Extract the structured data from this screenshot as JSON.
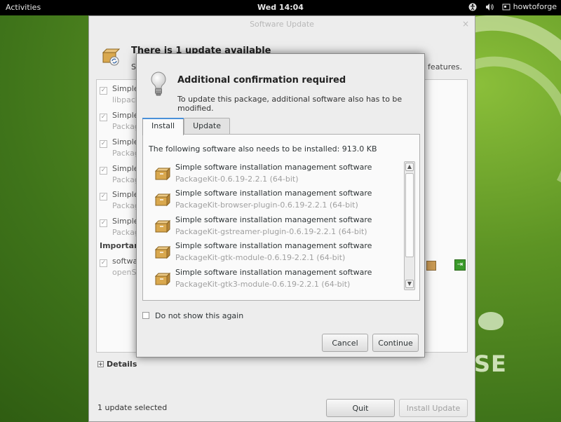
{
  "topbar": {
    "activities": "Activities",
    "clock": "Wed 14:04",
    "user": "howtoforge",
    "icons": [
      "accessibility-icon",
      "volume-icon",
      "user-icon"
    ]
  },
  "desktop": {
    "brand_text": "SE"
  },
  "software_update": {
    "title": "Software Update",
    "heading": "There is 1 update available",
    "subtitle_left": "S",
    "subtitle_right": "v features.",
    "rows": [
      {
        "line1": "Simple",
        "line2": "libpack"
      },
      {
        "line1": "Simple",
        "line2": "Packag"
      },
      {
        "line1": "Simple",
        "line2": "Packag"
      },
      {
        "line1": "Simple",
        "line2": "Packag"
      },
      {
        "line1": "Simple",
        "line2": "Packag"
      },
      {
        "line1": "Simple",
        "line2": "Packag"
      }
    ],
    "important_label": "Importan",
    "important_row": {
      "line1": "softwa",
      "line2": "openS"
    },
    "details_label": "Details",
    "status": "1 update selected",
    "quit_label": "Quit",
    "install_label": "Install Update"
  },
  "dialog": {
    "title": "Additional confirmation required",
    "description": "To update this package, additional software also has to be modified.",
    "tabs": [
      {
        "label": "Install",
        "active": true
      },
      {
        "label": "Update",
        "active": false
      }
    ],
    "intro": "The following software also needs to be installed: 913.0 KB",
    "packages": [
      {
        "name": "Simple software installation management software",
        "version": "PackageKit-0.6.19-2.2.1 (64-bit)"
      },
      {
        "name": "Simple software installation management software",
        "version": "PackageKit-browser-plugin-0.6.19-2.2.1 (64-bit)"
      },
      {
        "name": "Simple software installation management software",
        "version": "PackageKit-gstreamer-plugin-0.6.19-2.2.1 (64-bit)"
      },
      {
        "name": "Simple software installation management software",
        "version": "PackageKit-gtk-module-0.6.19-2.2.1 (64-bit)"
      },
      {
        "name": "Simple software installation management software",
        "version": "PackageKit-gtk3-module-0.6.19-2.2.1 (64-bit)"
      }
    ],
    "dont_show_label": "Do not show this again",
    "cancel_label": "Cancel",
    "continue_label": "Continue"
  },
  "colors": {
    "accent": "#4a90d9",
    "desktop_green": "#5d9424",
    "topbar": "#000000"
  }
}
